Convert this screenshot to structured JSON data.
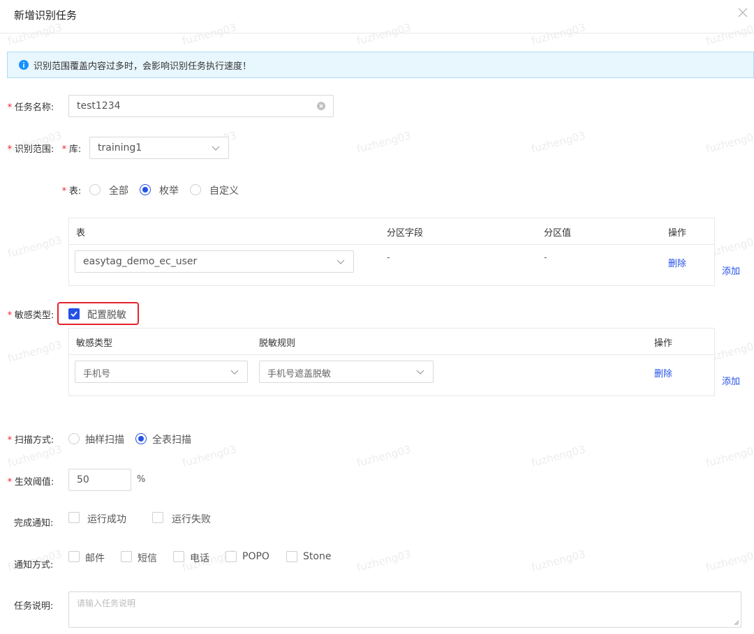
{
  "modal": {
    "title": "新增识别任务"
  },
  "alert": {
    "text": "识别范围覆盖内容过多时，会影响识别任务执行速度！"
  },
  "form": {
    "task_name": {
      "label": "任务名称:",
      "value": "test1234"
    },
    "scope": {
      "label": "识别范围:",
      "db_label": "库:",
      "db_value": "training1",
      "table_label": "表:",
      "table_options": [
        "全部",
        "枚举",
        "自定义"
      ],
      "table_selected": "枚举",
      "table_columns": [
        "表",
        "分区字段",
        "分区值",
        "操作"
      ],
      "rows": [
        {
          "table": "easytag_demo_ec_user",
          "partition_field": "-",
          "partition_value": "-",
          "action": "删除"
        }
      ],
      "add": "添加"
    },
    "sensitive": {
      "label": "敏感类型:",
      "checkbox_label": "配置脱敏",
      "checked": true,
      "columns": [
        "敏感类型",
        "脱敏规则",
        "操作"
      ],
      "rows": [
        {
          "type": "手机号",
          "rule": "手机号遮盖脱敏",
          "action": "删除"
        }
      ],
      "add": "添加"
    },
    "scan": {
      "label": "扫描方式:",
      "options": [
        "抽样扫描",
        "全表扫描"
      ],
      "selected": "全表扫描"
    },
    "threshold": {
      "label": "生效阈值:",
      "value": "50",
      "unit": "%"
    },
    "notify_on": {
      "label": "完成通知:",
      "options": [
        "运行成功",
        "运行失败"
      ]
    },
    "notify_via": {
      "label": "通知方式:",
      "options": [
        "邮件",
        "短信",
        "电话",
        "POPO",
        "Stone"
      ]
    },
    "description": {
      "label": "任务说明:",
      "placeholder": "请输入任务说明"
    }
  },
  "watermark": "fuzheng03",
  "colors": {
    "primary": "#2451e6",
    "required": "#f5222d",
    "highlight": "#e5232e",
    "alert_bg": "#e8f6fd"
  }
}
